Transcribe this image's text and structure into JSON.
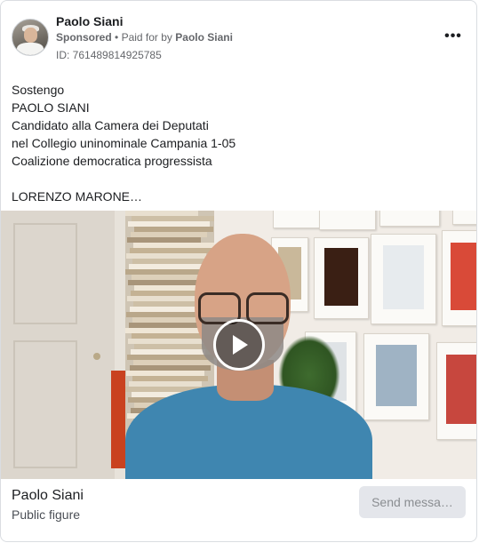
{
  "post": {
    "page_name": "Paolo Siani",
    "sponsored_label": "Sponsored",
    "separator": "•",
    "paid_for_prefix": "Paid for by",
    "payer": "Paolo Siani",
    "ad_id": "ID: 761489814925785",
    "more_icon": "more-horizontal-icon",
    "more_glyph": "•••",
    "body_text": "Sostengo\nPAOLO SIANI\nCandidato alla Camera dei Deputati\nnel Collegio uninominale Campania 1-05\nCoalizione democratica progressista\n\nLORENZO MARONE…"
  },
  "media": {
    "type": "video",
    "play_icon": "play-icon"
  },
  "footer": {
    "name": "Paolo Siani",
    "category": "Public figure",
    "cta_label": "Send messa…"
  },
  "colors": {
    "text_primary": "#1c1e21",
    "text_secondary": "#65676b",
    "cta_bg": "#e4e6eb",
    "shirt": "#3f86b0"
  }
}
